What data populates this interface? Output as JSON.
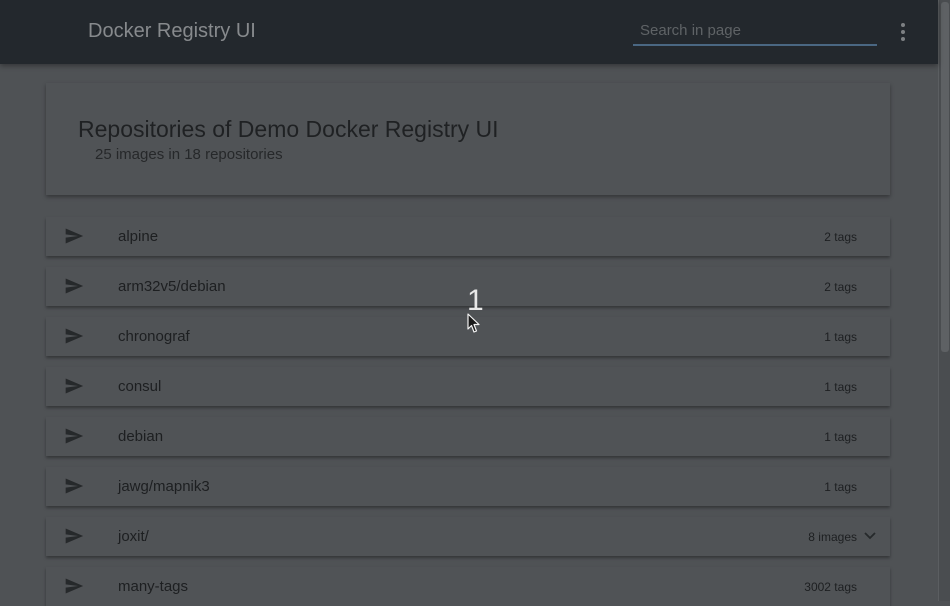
{
  "topbar": {
    "title": "Docker Registry UI",
    "search_placeholder": "Search in page",
    "menu_icon": "more-vert-icon"
  },
  "header": {
    "title": "Repositories of Demo Docker Registry UI",
    "subtitle": "25 images in 18 repositories"
  },
  "repo_icon": "send-icon",
  "repositories": [
    {
      "name": "alpine",
      "count": "2 tags"
    },
    {
      "name": "arm32v5/debian",
      "count": "2 tags"
    },
    {
      "name": "chronograf",
      "count": "1 tags"
    },
    {
      "name": "consul",
      "count": "1 tags"
    },
    {
      "name": "debian",
      "count": "1 tags"
    },
    {
      "name": "jawg/mapnik3",
      "count": "1 tags"
    },
    {
      "name": "joxit/",
      "count": "8 images",
      "expandable": true
    },
    {
      "name": "many-tags",
      "count": "3002 tags"
    }
  ],
  "overlay": {
    "number": "1"
  },
  "colors": {
    "topbar": "#23282d",
    "background": "#4f5255",
    "card": "#505356",
    "search_underline": "#4a6782"
  }
}
